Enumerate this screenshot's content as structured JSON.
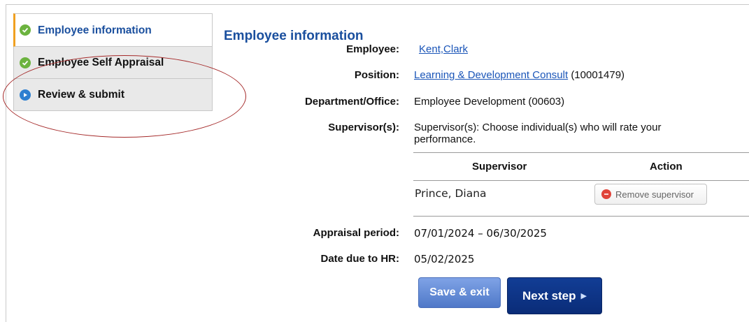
{
  "sidebar": {
    "items": [
      {
        "label": "Employee information",
        "status": "complete"
      },
      {
        "label": "Employee Self Appraisal",
        "status": "complete"
      },
      {
        "label": "Review & submit",
        "status": "next"
      }
    ]
  },
  "main": {
    "title": "Employee information",
    "fields": {
      "employee_label": "Employee:",
      "employee_value": "Kent,Clark",
      "position_label": "Position:",
      "position_link": "Learning & Development Consult",
      "position_code": "(10001479)",
      "department_label": "Department/Office:",
      "department_value": "Employee Development (00603)",
      "supervisors_label": "Supervisor(s):",
      "supervisors_help": "Supervisor(s): Choose individual(s) who will rate your performance.",
      "appraisal_label": "Appraisal period:",
      "appraisal_value": "07/01/2024 – 06/30/2025",
      "due_label": "Date due to HR:",
      "due_value": "05/02/2025"
    },
    "supervisor_table": {
      "headers": [
        "Supervisor",
        "Action"
      ],
      "rows": [
        {
          "name": "Prince, Diana",
          "action": "Remove supervisor"
        }
      ]
    },
    "buttons": {
      "save_exit": "Save & exit",
      "next_step": "Next step"
    }
  },
  "colors": {
    "brand_blue": "#1a4f9e",
    "link_blue": "#1a55b8",
    "complete_green": "#6cb33f",
    "next_blue": "#2d7fd0",
    "annotation_red": "#a52a2a"
  }
}
